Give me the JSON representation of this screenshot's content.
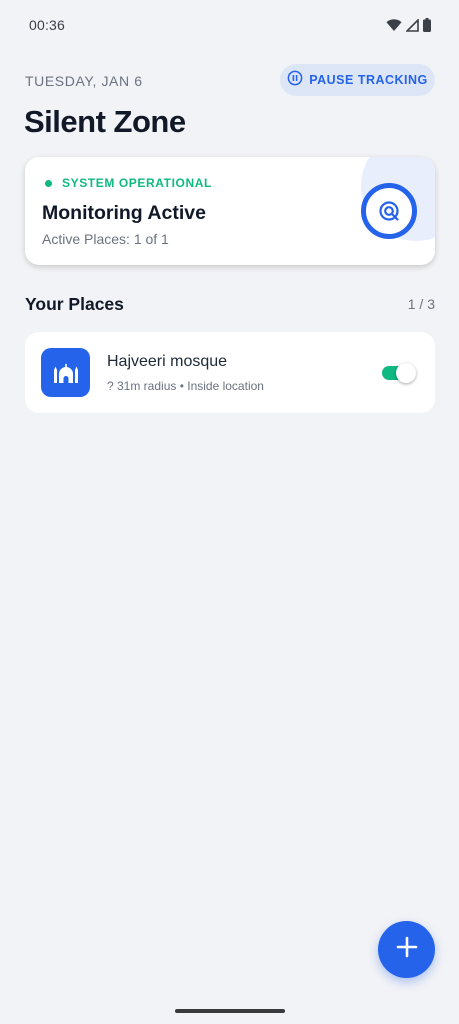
{
  "status_bar": {
    "time": "00:36",
    "icons": [
      "wifi-icon",
      "cell-signal-icon",
      "battery-icon"
    ]
  },
  "header": {
    "date": "TUESDAY, JAN 6",
    "pause_button_label": "PAUSE TRACKING",
    "title": "Silent Zone"
  },
  "status_card": {
    "status_label": "SYSTEM OPERATIONAL",
    "title": "Monitoring Active",
    "subtitle": "Active Places: 1 of 1",
    "icon": "radar-icon"
  },
  "places_section": {
    "title": "Your Places",
    "count": "1 / 3",
    "items": [
      {
        "name": "Hajveeri mosque",
        "meta": "? 31m radius • Inside location",
        "icon": "mosque-icon",
        "enabled": true
      }
    ]
  },
  "fab": {
    "icon": "plus-icon"
  },
  "colors": {
    "accent": "#2563eb",
    "success": "#10b981",
    "background": "#f2f3f6"
  }
}
